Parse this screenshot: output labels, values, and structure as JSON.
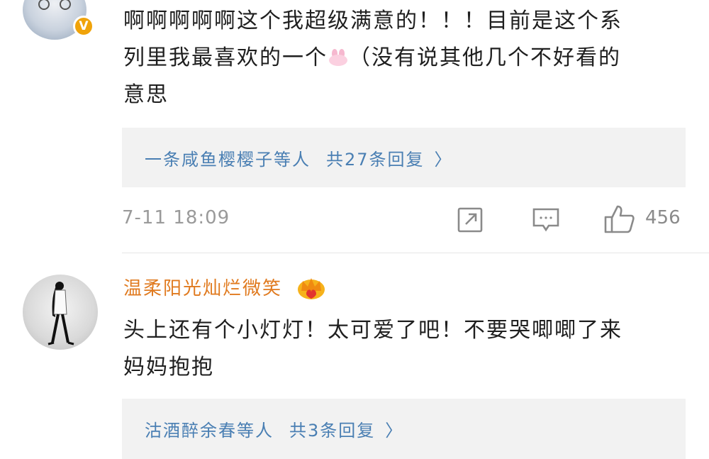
{
  "comment1": {
    "text_line1": "啊啊啊啊啊这个我超级满意的！！！目前是这个系",
    "text_line2a": "列里我最喜欢的一个",
    "text_line2b": "（没有说其他几个不好看的",
    "text_line3": "意思",
    "verified_badge": "V",
    "replies": {
      "names": "一条咸鱼樱樱子等人",
      "count": "共27条回复",
      "chevron": "〉"
    },
    "time": "7-11 18:09",
    "like_count": "456"
  },
  "comment2": {
    "username": "温柔阳光灿烂微笑",
    "text_line1": "头上还有个小灯灯！太可爱了吧！不要哭唧唧了来",
    "text_line2": "妈妈抱抱",
    "replies": {
      "names": "沽酒醉余春等人",
      "count": "共3条回复",
      "chevron": "〉"
    }
  },
  "colors": {
    "reply_link": "#4a7fb3",
    "username": "#e07a1f",
    "reply_bg": "#f2f2f2",
    "icon_gray": "#8a8a8a",
    "badge": "#f0a30a"
  },
  "icons": [
    "share-icon",
    "comment-icon",
    "like-icon",
    "crown-icon",
    "bunny-emoji"
  ]
}
